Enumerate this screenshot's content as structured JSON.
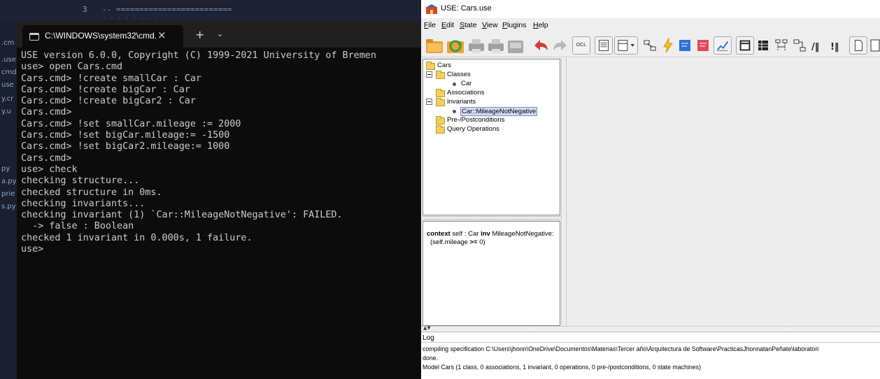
{
  "editor": {
    "line_number": "3",
    "line_text": "-- =========================",
    "line_text_2": "- - - - - - - -",
    "gutter_fragments": [
      ".cm",
      ".use",
      "cmd",
      "use",
      "y.cr",
      "y.u",
      "py",
      "a.py",
      "prie",
      "s.py"
    ]
  },
  "terminal": {
    "tab_title": "C:\\WINDOWS\\system32\\cmd.",
    "close_glyph": "×",
    "new_tab_glyph": "+",
    "dropdown_glyph": "⌄",
    "lines": [
      "USE version 6.0.0, Copyright (C) 1999-2021 University of Bremen",
      "use> open Cars.cmd",
      "Cars.cmd> !create smallCar : Car",
      "Cars.cmd> !create bigCar : Car",
      "Cars.cmd> !create bigCar2 : Car",
      "Cars.cmd>",
      "Cars.cmd> !set smallCar.mileage := 2000",
      "Cars.cmd> !set bigCar.mileage:= -1500",
      "Cars.cmd> !set bigCar2.mileage:= 1000",
      "Cars.cmd>",
      "use> check",
      "checking structure...",
      "checked structure in 0ms.",
      "checking invariants...",
      "checking invariant (1) `Car::MileageNotNegative': FAILED.",
      "  -> false : Boolean",
      "checked 1 invariant in 0.000s, 1 failure.",
      "use>"
    ]
  },
  "use_app": {
    "title": "USE: Cars.use",
    "menu": [
      {
        "mnemonic": "F",
        "rest": "ile"
      },
      {
        "mnemonic": "E",
        "rest": "dit"
      },
      {
        "mnemonic": "S",
        "rest": "tate"
      },
      {
        "mnemonic": "V",
        "rest": "iew"
      },
      {
        "mnemonic": "P",
        "rest": "lugins"
      },
      {
        "mnemonic": "H",
        "rest": "elp"
      }
    ],
    "toolbar": {
      "ocl_label": "OCL",
      "icons": [
        "open-icon",
        "reload-icon",
        "print-icon",
        "print-preview-icon",
        "print-view-icon",
        "undo-icon",
        "redo-icon",
        "ocl-evaluate-icon",
        "class-list-icon",
        "class-diagram-icon",
        "object-diagram-icon",
        "class-invariant-icon",
        "object-properties-icon",
        "class-extent-icon",
        "state-evolution-icon",
        "object-count-icon",
        "link-count-icon",
        "sequence-diagram-icon",
        "communication-diagram-icon",
        "call-stack-icon",
        "command-list-icon",
        "document-icon"
      ],
      "colors": {
        "folder": "#e8a23a",
        "arrow": "#d43a3a",
        "green": "#3e9a3e",
        "blue": "#2f6fd6",
        "yellow": "#f0c020"
      }
    },
    "tree": {
      "root": "Cars",
      "classes": "Classes",
      "class_car": "Car",
      "associations": "Associations",
      "invariants": "Invariants",
      "invariant_item": "Car::MileageNotNegative",
      "prepost": "Pre-/Postconditions",
      "query_ops": "Query Operations"
    },
    "definition": {
      "kw_context": "context",
      "text_1": " self : Car ",
      "kw_inv": "inv",
      "text_2": " MileageNotNegative:",
      "text_3": "(self.mileage ",
      "kw_op": ">=",
      "text_4": " 0)"
    },
    "log": {
      "label": "Log",
      "lines": [
        "compiling specification C:\\Users\\jhonn\\OneDrive\\Documentos\\Materias\\Tercer año\\Arquitectura de Software\\PracticasJhonnatanPeñate\\laboratori",
        "done.",
        "Model Cars (1 class, 0 associations, 1 invariant, 0 operations, 0 pre-/postconditions, 0 state machines)"
      ]
    }
  }
}
